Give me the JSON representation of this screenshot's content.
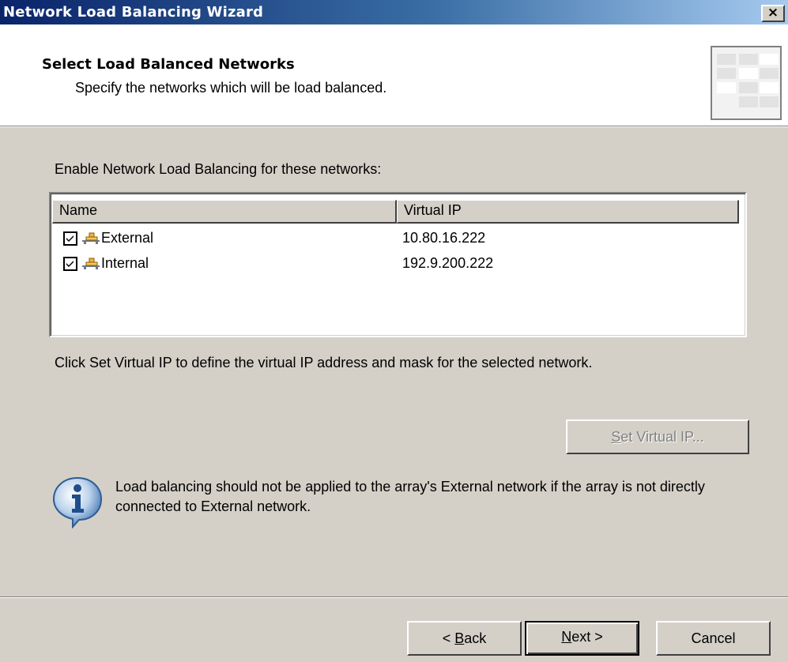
{
  "window": {
    "title": "Network Load Balancing Wizard",
    "close_glyph": "×"
  },
  "header": {
    "title": "Select Load Balanced Networks",
    "subtitle": "Specify the networks which will be load balanced."
  },
  "enable_label": "Enable Network Load Balancing for these networks:",
  "list": {
    "columns": [
      "Name",
      "Virtual IP"
    ],
    "rows": [
      {
        "checked": true,
        "icon": "network-icon",
        "name": "External",
        "virtual_ip": "10.80.16.222"
      },
      {
        "checked": true,
        "icon": "network-icon",
        "name": "Internal",
        "virtual_ip": "192.9.200.222"
      }
    ]
  },
  "hint": "Click Set Virtual IP to define the virtual IP address and mask for the selected network.",
  "set_vip": {
    "mnemonic": "S",
    "rest": "et Virtual IP...",
    "enabled": false
  },
  "info": {
    "icon": "info-icon",
    "text": "Load balancing should not be applied to the array's External network if the array is not directly connected to External network."
  },
  "footer": {
    "back": {
      "prefix": "< ",
      "mnemonic": "B",
      "rest": "ack"
    },
    "next": {
      "mnemonic": "N",
      "rest": "ext >"
    },
    "cancel": "Cancel"
  },
  "colors": {
    "titlebar_start": "#0a246a",
    "titlebar_end": "#a6caf0",
    "face": "#d4d0c8"
  }
}
